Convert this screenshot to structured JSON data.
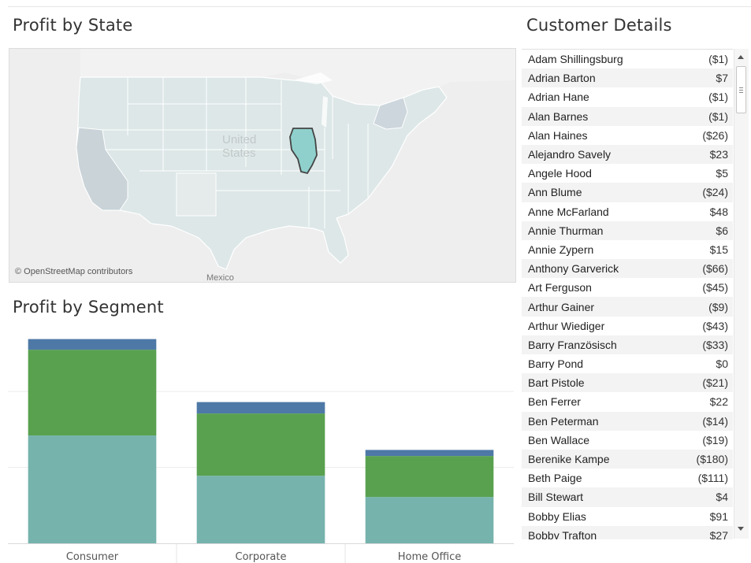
{
  "map_section": {
    "title": "Profit by State",
    "label_country": "United\nStates",
    "label_country_line1": "United",
    "label_country_line2": "States",
    "label_mexico": "Mexico",
    "attribution": "© OpenStreetMap contributors",
    "highlighted_state": "Illinois",
    "colors": {
      "land": "#dde8e8",
      "highlight": "#8fd0cc",
      "outline": "#444444"
    }
  },
  "segment_section": {
    "title": "Profit by Segment"
  },
  "chart_data": {
    "type": "bar",
    "stacked": true,
    "categories": [
      "Consumer",
      "Corporate",
      "Home Office"
    ],
    "series": [
      {
        "color": "#76b3ad",
        "values": [
          142,
          89,
          61
        ]
      },
      {
        "color": "#59a14f",
        "values": [
          113,
          82,
          54
        ]
      },
      {
        "color": "#4e79a7",
        "values": [
          14,
          15,
          8
        ]
      }
    ],
    "ylim": [
      0,
      280
    ],
    "grid": true,
    "gridlines_at": [
      100,
      200
    ]
  },
  "customer_section": {
    "title": "Customer Details",
    "rows": [
      {
        "name": "Adam Shillingsburg",
        "profit": "($1)"
      },
      {
        "name": "Adrian Barton",
        "profit": "$7"
      },
      {
        "name": "Adrian Hane",
        "profit": "($1)"
      },
      {
        "name": "Alan Barnes",
        "profit": "($1)"
      },
      {
        "name": "Alan Haines",
        "profit": "($26)"
      },
      {
        "name": "Alejandro Savely",
        "profit": "$23"
      },
      {
        "name": "Angele Hood",
        "profit": "$5"
      },
      {
        "name": "Ann Blume",
        "profit": "($24)"
      },
      {
        "name": "Anne McFarland",
        "profit": "$48"
      },
      {
        "name": "Annie Thurman",
        "profit": "$6"
      },
      {
        "name": "Annie Zypern",
        "profit": "$15"
      },
      {
        "name": "Anthony Garverick",
        "profit": "($66)"
      },
      {
        "name": "Art Ferguson",
        "profit": "($45)"
      },
      {
        "name": "Arthur Gainer",
        "profit": "($9)"
      },
      {
        "name": "Arthur Wiediger",
        "profit": "($43)"
      },
      {
        "name": "Barry Französisch",
        "profit": "($33)"
      },
      {
        "name": "Barry Pond",
        "profit": "$0"
      },
      {
        "name": "Bart Pistole",
        "profit": "($21)"
      },
      {
        "name": "Ben Ferrer",
        "profit": "$22"
      },
      {
        "name": "Ben Peterman",
        "profit": "($14)"
      },
      {
        "name": "Ben Wallace",
        "profit": "($19)"
      },
      {
        "name": "Berenike Kampe",
        "profit": "($180)"
      },
      {
        "name": "Beth Paige",
        "profit": "($111)"
      },
      {
        "name": "Bill Stewart",
        "profit": "$4"
      },
      {
        "name": "Bobby Elias",
        "profit": "$91"
      },
      {
        "name": "Bobby Trafton",
        "profit": "$27"
      }
    ]
  }
}
